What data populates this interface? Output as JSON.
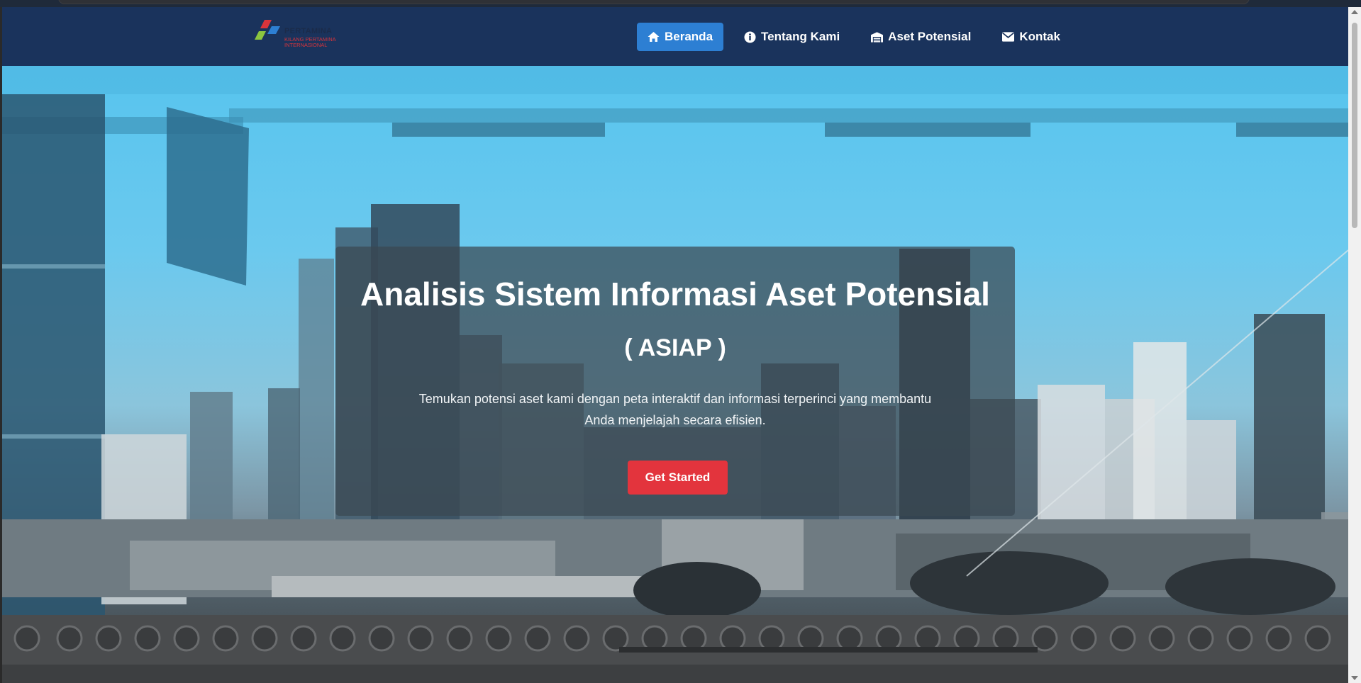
{
  "brand": {
    "logo_name": "PERTAMINA",
    "logo_sub_1": "KILANG PERTAMINA",
    "logo_sub_2": "INTERNASIONAL"
  },
  "nav": {
    "items": [
      {
        "label": "Beranda",
        "icon": "home-icon",
        "active": true
      },
      {
        "label": "Tentang Kami",
        "icon": "info-icon",
        "active": false
      },
      {
        "label": "Aset Potensial",
        "icon": "warehouse-icon",
        "active": false
      },
      {
        "label": "Kontak",
        "icon": "envelope-icon",
        "active": false
      }
    ]
  },
  "hero": {
    "title": "Analisis Sistem Informasi Aset Potensial",
    "subtitle": "( ASIAP )",
    "description": "Temukan potensi aset kami dengan peta interaktif dan informasi terperinci yang membantu Anda menjelajah secara efisien.",
    "cta_label": "Get Started"
  },
  "colors": {
    "navbar_bg": "#1a335c",
    "active_nav": "#2d7fd3",
    "cta": "#e3343d",
    "hero_sky": "#57c4ee"
  }
}
